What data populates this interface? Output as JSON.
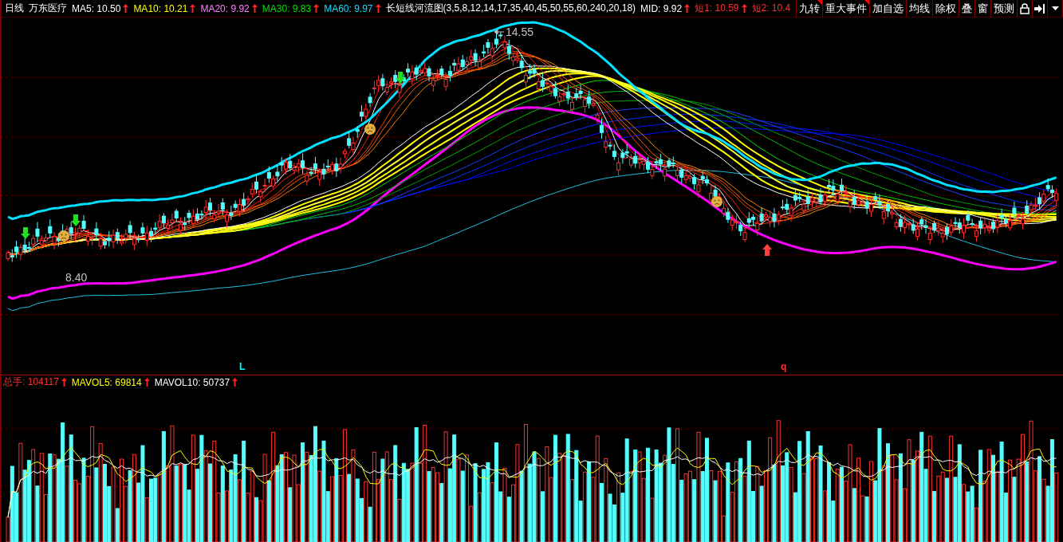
{
  "header": {
    "period": "日线",
    "stock": "万东医疗",
    "indicators": [
      {
        "text": "MA5: 10.50",
        "color": "#ffffff",
        "arrow": true
      },
      {
        "text": "MA10: 10.21",
        "color": "#ffff00",
        "arrow": true
      },
      {
        "text": "MA20: 9.92",
        "color": "#ff80ff",
        "arrow": true
      },
      {
        "text": "MA30: 9.83",
        "color": "#00e000",
        "arrow": true
      },
      {
        "text": "MA60: 9.97",
        "color": "#00e0ff",
        "arrow": true
      },
      {
        "text": "长短线河流图(3,5,8,12,14,17,35,40,45,50,55,60,240,20,18)",
        "color": "#ffffff",
        "arrow": false
      },
      {
        "text": "MID: 9.92",
        "color": "#ffffff",
        "arrow": true
      },
      {
        "text": "短1: 10.59",
        "color": "#ff3030",
        "arrow": true
      },
      {
        "text": "短2: 10.4",
        "color": "#ff3030",
        "arrow": false
      }
    ]
  },
  "toolbar": [
    {
      "label": "九转",
      "flagged": true
    },
    {
      "label": "重大事件",
      "flagged": true
    },
    {
      "label": "加自选",
      "flagged": false
    },
    {
      "label": "均线",
      "flagged": false
    },
    {
      "label": "除权",
      "flagged": false
    },
    {
      "label": "叠",
      "flagged": false
    },
    {
      "label": "窗",
      "flagged": false
    },
    {
      "label": "预测",
      "flagged": false
    }
  ],
  "chart": {
    "annotations": [
      {
        "kind": "high",
        "text": "14.55"
      },
      {
        "kind": "low",
        "text": "8.40"
      }
    ],
    "markers": [
      {
        "text": "L",
        "color": "#00ffff"
      },
      {
        "text": "q",
        "color": "#ff3030"
      }
    ]
  },
  "volume": {
    "indicators": [
      {
        "text": "总手: 104117",
        "color": "#ff3030",
        "arrow": true
      },
      {
        "text": "MAVOL5: 69814",
        "color": "#ffff00",
        "arrow": true
      },
      {
        "text": "MAVOL10: 50737",
        "color": "#ffffff",
        "arrow": true
      }
    ]
  }
}
